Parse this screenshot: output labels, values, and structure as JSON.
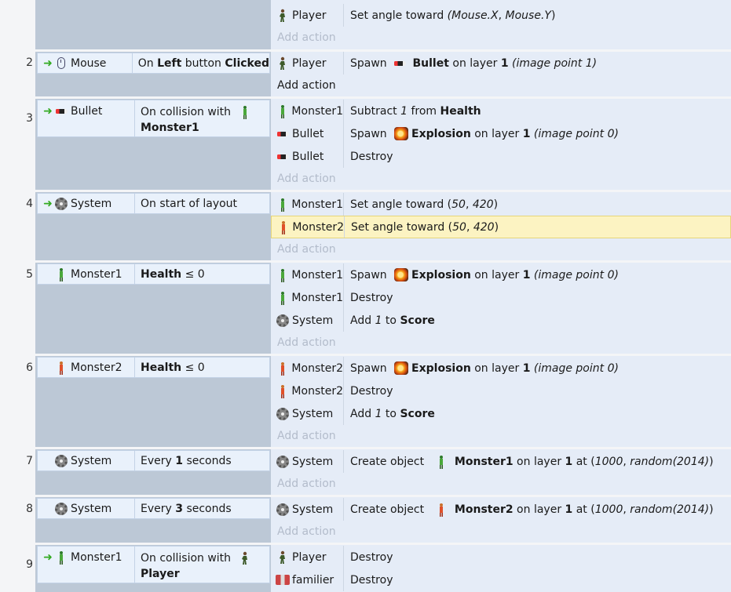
{
  "add_action_label": "Add action",
  "events": [
    {
      "number": "",
      "actions": [
        {
          "object": "Player",
          "icon": "player-icon",
          "text": [
            [
              "n",
              "Set angle toward "
            ],
            [
              "i",
              "("
            ],
            [
              "i",
              "Mouse.X"
            ],
            [
              "n",
              ", "
            ],
            [
              "i",
              "Mouse.Y"
            ],
            [
              "n",
              ")"
            ]
          ]
        }
      ]
    },
    {
      "number": "2",
      "condition": {
        "object": "Mouse",
        "icon": "mouse-icon",
        "trigger": true,
        "text": [
          [
            "n",
            "On "
          ],
          [
            "b",
            "Left"
          ],
          [
            "n",
            " button "
          ],
          [
            "b",
            "Clicked"
          ]
        ]
      },
      "actions": [
        {
          "object": "Player",
          "icon": "player-icon",
          "text": [
            [
              "n",
              "Spawn "
            ],
            [
              "icon",
              "bullet-icon"
            ],
            [
              "b",
              "Bullet"
            ],
            [
              "n",
              " on layer "
            ],
            [
              "b",
              "1"
            ],
            [
              "n",
              " "
            ],
            [
              "i",
              "(image point 1)"
            ]
          ]
        }
      ]
    },
    {
      "number": "3",
      "condition": {
        "object": "Bullet",
        "icon": "bullet-icon",
        "trigger": true,
        "line1": "On collision with",
        "line2": "Monster1"
      },
      "actions": [
        {
          "object": "Monster1",
          "icon": "monster1-icon",
          "text": [
            [
              "n",
              "Subtract "
            ],
            [
              "i",
              "1"
            ],
            [
              "n",
              " from "
            ],
            [
              "b",
              "Health"
            ]
          ]
        },
        {
          "object": "Bullet",
          "icon": "bullet-icon",
          "text": [
            [
              "n",
              "Spawn "
            ],
            [
              "icon",
              "explosion-icon"
            ],
            [
              "b",
              "Explosion"
            ],
            [
              "n",
              " on layer "
            ],
            [
              "b",
              "1"
            ],
            [
              "n",
              " "
            ],
            [
              "i",
              "(image point 0)"
            ]
          ]
        },
        {
          "object": "Bullet",
          "icon": "bullet-icon",
          "text": [
            [
              "n",
              "Destroy"
            ]
          ]
        }
      ]
    },
    {
      "number": "4",
      "condition": {
        "object": "System",
        "icon": "gear-icon",
        "trigger": true,
        "text": [
          [
            "n",
            "On start of layout"
          ]
        ]
      },
      "actions": [
        {
          "object": "Monster1",
          "icon": "monster1-icon",
          "text": [
            [
              "n",
              "Set angle toward ("
            ],
            [
              "i",
              "50"
            ],
            [
              "n",
              ", "
            ],
            [
              "i",
              "420"
            ],
            [
              "n",
              ")"
            ]
          ]
        },
        {
          "object": "Monster2",
          "icon": "monster2-icon",
          "highlighted": true,
          "text": [
            [
              "n",
              "Set angle toward ("
            ],
            [
              "i",
              "50"
            ],
            [
              "n",
              ", "
            ],
            [
              "i",
              "420"
            ],
            [
              "n",
              ")"
            ]
          ]
        }
      ]
    },
    {
      "number": "5",
      "condition": {
        "object": "Monster1",
        "icon": "monster1-icon",
        "trigger": false,
        "text": [
          [
            "b",
            "Health"
          ],
          [
            "n",
            " ≤ 0"
          ]
        ]
      },
      "actions": [
        {
          "object": "Monster1",
          "icon": "monster1-icon",
          "text": [
            [
              "n",
              "Spawn "
            ],
            [
              "icon",
              "explosion-icon"
            ],
            [
              "b",
              "Explosion"
            ],
            [
              "n",
              " on layer "
            ],
            [
              "b",
              "1"
            ],
            [
              "n",
              " "
            ],
            [
              "i",
              "(image point 0)"
            ]
          ]
        },
        {
          "object": "Monster1",
          "icon": "monster1-icon",
          "text": [
            [
              "n",
              "Destroy"
            ]
          ]
        },
        {
          "object": "System",
          "icon": "gear-icon",
          "text": [
            [
              "n",
              "Add "
            ],
            [
              "i",
              "1"
            ],
            [
              "n",
              " to "
            ],
            [
              "b",
              "Score"
            ]
          ]
        }
      ]
    },
    {
      "number": "6",
      "condition": {
        "object": "Monster2",
        "icon": "monster2-icon",
        "trigger": false,
        "text": [
          [
            "b",
            "Health"
          ],
          [
            "n",
            " ≤ 0"
          ]
        ]
      },
      "actions": [
        {
          "object": "Monster2",
          "icon": "monster2-icon",
          "text": [
            [
              "n",
              "Spawn "
            ],
            [
              "icon",
              "explosion-icon"
            ],
            [
              "b",
              "Explosion"
            ],
            [
              "n",
              " on layer "
            ],
            [
              "b",
              "1"
            ],
            [
              "n",
              " "
            ],
            [
              "i",
              "(image point 0)"
            ]
          ]
        },
        {
          "object": "Monster2",
          "icon": "monster2-icon",
          "text": [
            [
              "n",
              "Destroy"
            ]
          ]
        },
        {
          "object": "System",
          "icon": "gear-icon",
          "text": [
            [
              "n",
              "Add "
            ],
            [
              "i",
              "1"
            ],
            [
              "n",
              " to "
            ],
            [
              "b",
              "Score"
            ]
          ]
        }
      ]
    },
    {
      "number": "7",
      "condition": {
        "object": "System",
        "icon": "gear-icon",
        "trigger": false,
        "text": [
          [
            "n",
            "Every "
          ],
          [
            "b",
            "1"
          ],
          [
            "n",
            " seconds"
          ]
        ]
      },
      "actions": [
        {
          "object": "System",
          "icon": "gear-icon",
          "text": [
            [
              "n",
              "Create object "
            ],
            [
              "icon",
              "monster1-icon"
            ],
            [
              "b",
              "Monster1"
            ],
            [
              "n",
              " on layer "
            ],
            [
              "b",
              "1"
            ],
            [
              "n",
              " at ("
            ],
            [
              "i",
              "1000"
            ],
            [
              "n",
              ", "
            ],
            [
              "i",
              "random(2014)"
            ],
            [
              "n",
              ")"
            ]
          ]
        }
      ]
    },
    {
      "number": "8",
      "condition": {
        "object": "System",
        "icon": "gear-icon",
        "trigger": false,
        "text": [
          [
            "n",
            "Every "
          ],
          [
            "b",
            "3"
          ],
          [
            "n",
            " seconds"
          ]
        ]
      },
      "actions": [
        {
          "object": "System",
          "icon": "gear-icon",
          "text": [
            [
              "n",
              "Create object "
            ],
            [
              "icon",
              "monster2-icon"
            ],
            [
              "b",
              "Monster2"
            ],
            [
              "n",
              " on layer "
            ],
            [
              "b",
              "1"
            ],
            [
              "n",
              " at ("
            ],
            [
              "i",
              "1000"
            ],
            [
              "n",
              ", "
            ],
            [
              "i",
              "random(2014)"
            ],
            [
              "n",
              ")"
            ]
          ]
        }
      ]
    },
    {
      "number": "9",
      "condition": {
        "object": "Monster1",
        "icon": "monster1-icon",
        "trigger": true,
        "line1": "On collision with",
        "line2": "Player",
        "inline_icon": "player-icon"
      },
      "actions": [
        {
          "object": "Player",
          "icon": "player-icon",
          "text": [
            [
              "n",
              "Destroy"
            ]
          ]
        },
        {
          "object": "familier",
          "icon": "familier-icon",
          "text": [
            [
              "n",
              "Destroy"
            ]
          ]
        }
      ]
    }
  ]
}
